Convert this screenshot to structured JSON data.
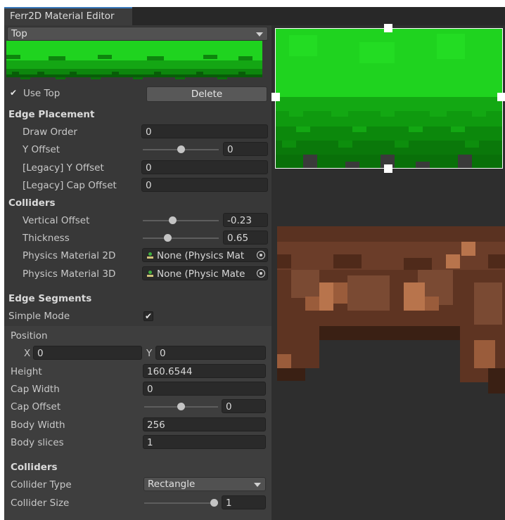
{
  "window": {
    "tab_title": "Ferr2D Material Editor"
  },
  "top_dropdown": {
    "value": "Top"
  },
  "use_top": {
    "label": "Use Top",
    "checked_glyph": "✔"
  },
  "delete_button": {
    "label": "Delete"
  },
  "edge_placement": {
    "header": "Edge Placement",
    "draw_order": {
      "label": "Draw Order",
      "value": "0"
    },
    "y_offset": {
      "label": "Y Offset",
      "value": "0",
      "slider_fraction": 0.5
    },
    "legacy_y_offset": {
      "label": "[Legacy] Y Offset",
      "value": "0"
    },
    "legacy_cap_offset": {
      "label": "[Legacy] Cap Offset",
      "value": "0"
    }
  },
  "colliders": {
    "header": "Colliders",
    "vertical_offset": {
      "label": "Vertical Offset",
      "value": "-0.23",
      "slider_fraction": 0.39
    },
    "thickness": {
      "label": "Thickness",
      "value": "0.65",
      "slider_fraction": 0.33
    },
    "physics_2d": {
      "label": "Physics Material 2D",
      "value": "None (Physics Mat",
      "icon": "physics-material-icon"
    },
    "physics_3d": {
      "label": "Physics Material 3D",
      "value": "None (Physic Mate",
      "icon": "physics-material-icon"
    }
  },
  "edge_segments": {
    "header": "Edge Segments",
    "simple_mode": {
      "label": "Simple Mode",
      "checked_glyph": "✔"
    }
  },
  "segment": {
    "position_label": "Position",
    "x": {
      "label": "X",
      "value": "0"
    },
    "y": {
      "label": "Y",
      "value": "0"
    },
    "height": {
      "label": "Height",
      "value": "160.6544"
    },
    "cap_width": {
      "label": "Cap Width",
      "value": "0"
    },
    "cap_offset": {
      "label": "Cap Offset",
      "value": "0",
      "slider_fraction": 0.5
    },
    "body_width": {
      "label": "Body Width",
      "value": "256"
    },
    "body_slices": {
      "label": "Body slices",
      "value": "1"
    },
    "colliders_header": "Colliders",
    "collider_type": {
      "label": "Collider Type",
      "value": "Rectangle"
    },
    "collider_size": {
      "label": "Collider Size",
      "value": "1",
      "slider_fraction": 0.95
    }
  },
  "colors": {
    "grass_light": "#1fd31f",
    "grass_mid": "#13a813",
    "grass_dark": "#0a7a0a",
    "dirt_light": "#b8744c",
    "dirt_mid": "#7a4a33",
    "dirt_dark": "#4f2a1a",
    "selection": "#ffffff"
  }
}
